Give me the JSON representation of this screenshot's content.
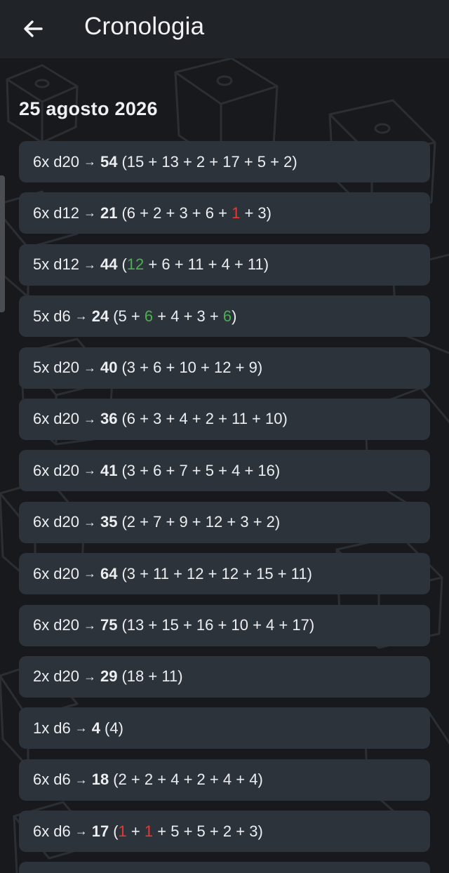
{
  "header": {
    "title": "Cronologia",
    "back_icon": "arrow-left-icon"
  },
  "date_heading": "25 agosto 2026",
  "colors": {
    "max_roll": "#4caf50",
    "min_roll": "#e53935",
    "row_background": "#2c333b",
    "app_background": "#17191c"
  },
  "rolls": [
    {
      "count": "6x",
      "die": "d20",
      "arrow": "→",
      "total": "54",
      "dice": [
        "15",
        "13",
        "2",
        "17",
        "5",
        "2"
      ],
      "highlights": [
        "",
        "",
        "",
        "",
        "",
        ""
      ]
    },
    {
      "count": "6x",
      "die": "d12",
      "arrow": "→",
      "total": "21",
      "dice": [
        "6",
        "2",
        "3",
        "6",
        "1",
        "3"
      ],
      "highlights": [
        "",
        "",
        "",
        "",
        "min",
        ""
      ]
    },
    {
      "count": "5x",
      "die": "d12",
      "arrow": "→",
      "total": "44",
      "dice": [
        "12",
        "6",
        "11",
        "4",
        "11"
      ],
      "highlights": [
        "max",
        "",
        "",
        "",
        ""
      ]
    },
    {
      "count": "5x",
      "die": "d6",
      "arrow": "→",
      "total": "24",
      "dice": [
        "5",
        "6",
        "4",
        "3",
        "6"
      ],
      "highlights": [
        "",
        "max",
        "",
        "",
        "max"
      ]
    },
    {
      "count": "5x",
      "die": "d20",
      "arrow": "→",
      "total": "40",
      "dice": [
        "3",
        "6",
        "10",
        "12",
        "9"
      ],
      "highlights": [
        "",
        "",
        "",
        "",
        ""
      ]
    },
    {
      "count": "6x",
      "die": "d20",
      "arrow": "→",
      "total": "36",
      "dice": [
        "6",
        "3",
        "4",
        "2",
        "11",
        "10"
      ],
      "highlights": [
        "",
        "",
        "",
        "",
        "",
        ""
      ]
    },
    {
      "count": "6x",
      "die": "d20",
      "arrow": "→",
      "total": "41",
      "dice": [
        "3",
        "6",
        "7",
        "5",
        "4",
        "16"
      ],
      "highlights": [
        "",
        "",
        "",
        "",
        "",
        ""
      ]
    },
    {
      "count": "6x",
      "die": "d20",
      "arrow": "→",
      "total": "35",
      "dice": [
        "2",
        "7",
        "9",
        "12",
        "3",
        "2"
      ],
      "highlights": [
        "",
        "",
        "",
        "",
        "",
        ""
      ]
    },
    {
      "count": "6x",
      "die": "d20",
      "arrow": "→",
      "total": "64",
      "dice": [
        "3",
        "11",
        "12",
        "12",
        "15",
        "11"
      ],
      "highlights": [
        "",
        "",
        "",
        "",
        "",
        ""
      ]
    },
    {
      "count": "6x",
      "die": "d20",
      "arrow": "→",
      "total": "75",
      "dice": [
        "13",
        "15",
        "16",
        "10",
        "4",
        "17"
      ],
      "highlights": [
        "",
        "",
        "",
        "",
        "",
        ""
      ]
    },
    {
      "count": "2x",
      "die": "d20",
      "arrow": "→",
      "total": "29",
      "dice": [
        "18",
        "11"
      ],
      "highlights": [
        "",
        ""
      ]
    },
    {
      "count": "1x",
      "die": "d6",
      "arrow": "→",
      "total": "4",
      "dice": [
        "4"
      ],
      "highlights": [
        ""
      ]
    },
    {
      "count": "6x",
      "die": "d6",
      "arrow": "→",
      "total": "18",
      "dice": [
        "2",
        "2",
        "4",
        "2",
        "4",
        "4"
      ],
      "highlights": [
        "",
        "",
        "",
        "",
        "",
        ""
      ]
    },
    {
      "count": "6x",
      "die": "d6",
      "arrow": "→",
      "total": "17",
      "dice": [
        "1",
        "1",
        "5",
        "5",
        "2",
        "3"
      ],
      "highlights": [
        "min",
        "min",
        "",
        "",
        "",
        ""
      ]
    },
    {
      "count": "",
      "die": "",
      "arrow": "",
      "total": "",
      "dice": [],
      "highlights": []
    }
  ]
}
